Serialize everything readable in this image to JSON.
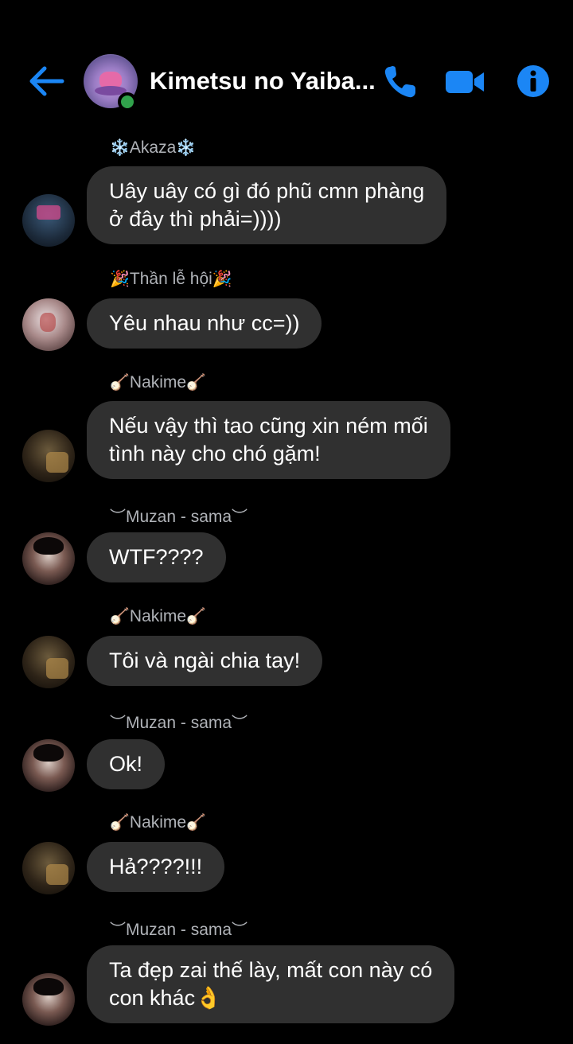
{
  "header": {
    "title": "Kimetsu no Yaiba...",
    "accent_color": "#1b86f5",
    "online_color": "#31a24c",
    "icons": {
      "back": "arrow-left-icon",
      "phone": "phone-icon",
      "video": "video-camera-icon",
      "info": "info-icon"
    }
  },
  "messages": [
    {
      "sender": "Akaza",
      "sender_deco_left": "❄️",
      "sender_deco_right": "❄️",
      "text_lines": [
        "Uây uây có gì đó phũ cmn phàng",
        "ở đây thì phải=))))"
      ]
    },
    {
      "sender": "Thần lễ hội",
      "sender_deco_left": "🎉",
      "sender_deco_right": "🎉",
      "text_lines": [
        "Yêu nhau như cc=))"
      ]
    },
    {
      "sender": "Nakime",
      "sender_deco_left": "🪕",
      "sender_deco_right": "🪕",
      "text_lines": [
        "Nếu vậy thì tao cũng xin ném mối",
        "tình này cho chó gặm!"
      ]
    },
    {
      "sender": "Muzan - sama",
      "sender_deco_left": "︶",
      "sender_deco_right": "︶",
      "text_lines": [
        "WTF????"
      ]
    },
    {
      "sender": "Nakime",
      "sender_deco_left": "🪕",
      "sender_deco_right": "🪕",
      "text_lines": [
        "Tôi và ngài chia tay!"
      ]
    },
    {
      "sender": "Muzan - sama",
      "sender_deco_left": "︶",
      "sender_deco_right": "︶",
      "text_lines": [
        "Ok!"
      ]
    },
    {
      "sender": "Nakime",
      "sender_deco_left": "🪕",
      "sender_deco_right": "🪕",
      "text_lines": [
        "Hả????!!!"
      ]
    },
    {
      "sender": "Muzan - sama",
      "sender_deco_left": "︶",
      "sender_deco_right": "︶",
      "text_lines": [
        "Ta đẹp zai thế lày, mất con này có",
        "con khác👌"
      ]
    }
  ]
}
